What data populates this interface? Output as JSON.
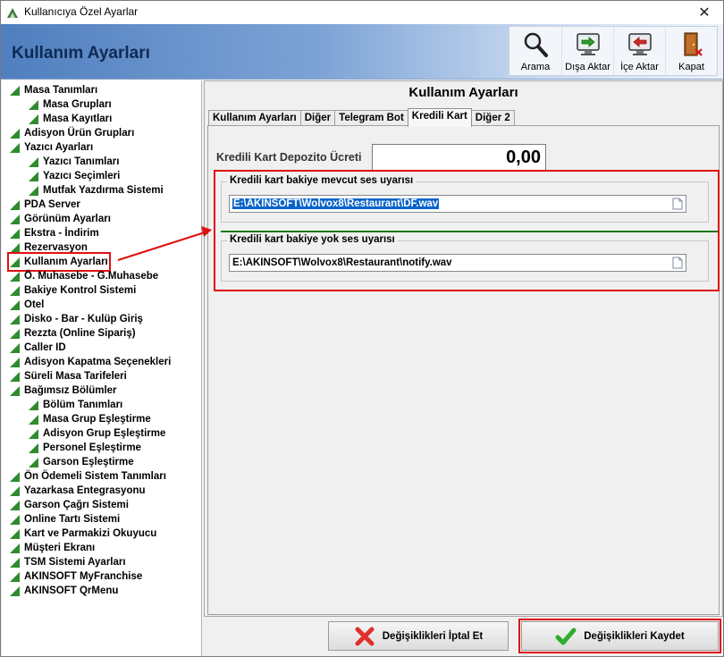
{
  "window": {
    "title": "Kullanıcıya Özel Ayarlar",
    "close_glyph": "✕"
  },
  "header": {
    "title": "Kullanım Ayarları"
  },
  "toolbar": [
    {
      "label": "Arama",
      "icon": "magnifier-icon"
    },
    {
      "label": "Dışa Aktar",
      "icon": "export-monitor-icon"
    },
    {
      "label": "İçe Aktar",
      "icon": "import-monitor-icon"
    },
    {
      "label": "Kapat",
      "icon": "exit-door-icon"
    }
  ],
  "tree": {
    "items": [
      {
        "label": "Masa Tanımları",
        "level": 0
      },
      {
        "label": "Masa Grupları",
        "level": 1
      },
      {
        "label": "Masa Kayıtları",
        "level": 1
      },
      {
        "label": "Adisyon Ürün Grupları",
        "level": 0
      },
      {
        "label": "Yazıcı Ayarları",
        "level": 0
      },
      {
        "label": "Yazıcı Tanımları",
        "level": 1
      },
      {
        "label": "Yazıcı Seçimleri",
        "level": 1
      },
      {
        "label": "Mutfak Yazdırma Sistemi",
        "level": 1
      },
      {
        "label": "PDA Server",
        "level": 0
      },
      {
        "label": "Görünüm Ayarları",
        "level": 0
      },
      {
        "label": "Ekstra - İndirim",
        "level": 0
      },
      {
        "label": "Rezervasyon",
        "level": 0
      },
      {
        "label": "Kullanım Ayarları",
        "level": 0,
        "selected": true
      },
      {
        "label": "Ö. Muhasebe - G.Muhasebe",
        "level": 0
      },
      {
        "label": "Bakiye Kontrol Sistemi",
        "level": 0
      },
      {
        "label": "Otel",
        "level": 0
      },
      {
        "label": "Disko - Bar - Kulüp Giriş",
        "level": 0
      },
      {
        "label": "Rezzta (Online Sipariş)",
        "level": 0
      },
      {
        "label": "Caller ID",
        "level": 0
      },
      {
        "label": "Adisyon Kapatma Seçenekleri",
        "level": 0
      },
      {
        "label": "Süreli Masa Tarifeleri",
        "level": 0
      },
      {
        "label": "Bağımsız Bölümler",
        "level": 0
      },
      {
        "label": "Bölüm Tanımları",
        "level": 1
      },
      {
        "label": "Masa Grup Eşleştirme",
        "level": 1
      },
      {
        "label": "Adisyon Grup Eşleştirme",
        "level": 1
      },
      {
        "label": "Personel Eşleştirme",
        "level": 1
      },
      {
        "label": "Garson Eşleştirme",
        "level": 1
      },
      {
        "label": "Ön Ödemeli Sistem Tanımları",
        "level": 0
      },
      {
        "label": "Yazarkasa Entegrasyonu",
        "level": 0
      },
      {
        "label": "Garson Çağrı Sistemi",
        "level": 0
      },
      {
        "label": "Online Tartı Sistemi",
        "level": 0
      },
      {
        "label": "Kart ve Parmakizi Okuyucu",
        "level": 0
      },
      {
        "label": "Müşteri Ekranı",
        "level": 0
      },
      {
        "label": "TSM Sistemi Ayarları",
        "level": 0
      },
      {
        "label": "AKINSOFT MyFranchise",
        "level": 0
      },
      {
        "label": "AKINSOFT QrMenu",
        "level": 0
      }
    ]
  },
  "main": {
    "title": "Kullanım Ayarları",
    "tabs": [
      {
        "label": "Kullanım Ayarları",
        "active": false
      },
      {
        "label": "Diğer",
        "active": false
      },
      {
        "label": "Telegram Bot",
        "active": false
      },
      {
        "label": "Kredili Kart",
        "active": true
      },
      {
        "label": "Diğer 2",
        "active": false
      }
    ],
    "deposit": {
      "label": "Kredili Kart Depozito Ücreti",
      "value": "0,00"
    },
    "groups": [
      {
        "title": "Kredili kart bakiye mevcut ses uyarısı",
        "value": "E:\\AKINSOFT\\Wolvox8\\Restaurant\\DF.wav",
        "selected": true
      },
      {
        "title": "Kredili kart bakiye yok ses uyarısı",
        "value": "E:\\AKINSOFT\\Wolvox8\\Restaurant\\notify.wav",
        "selected": false
      }
    ]
  },
  "buttons": {
    "cancel": "Değişiklikleri İptal Et",
    "save": "Değişiklikleri Kaydet"
  },
  "colors": {
    "annotation_red": "#e01010",
    "tree_triangle": "#2e8b2e",
    "selection_blue": "#0a64c8"
  }
}
